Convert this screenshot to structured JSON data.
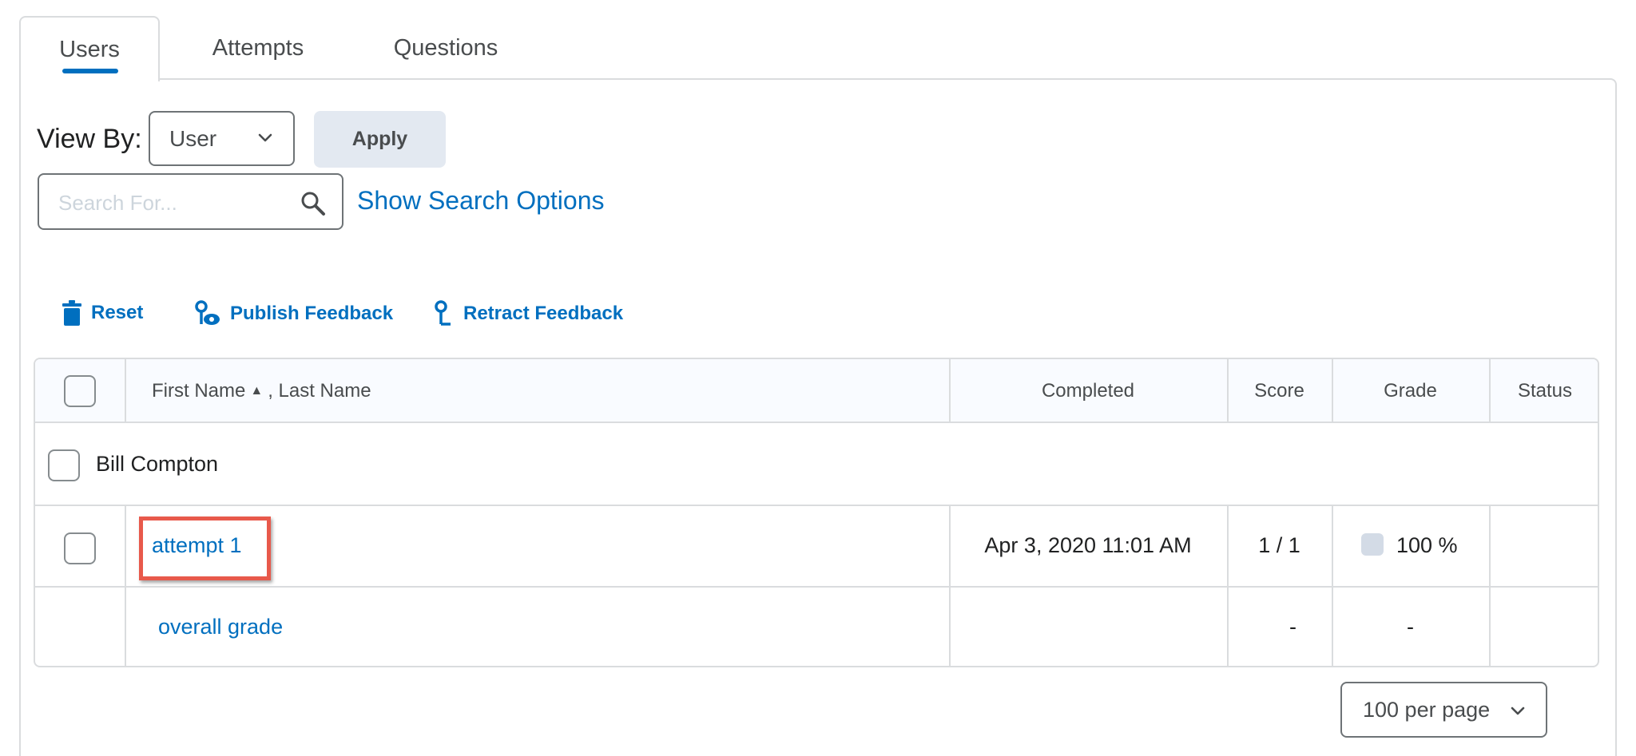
{
  "tabs": [
    {
      "label": "Users",
      "active": true
    },
    {
      "label": "Attempts",
      "active": false
    },
    {
      "label": "Questions",
      "active": false
    }
  ],
  "view_by": {
    "label": "View By:",
    "selected": "User",
    "apply_label": "Apply"
  },
  "search": {
    "placeholder": "Search For...",
    "value": "",
    "show_options_label": "Show Search Options"
  },
  "actions": {
    "reset": "Reset",
    "publish": "Publish Feedback",
    "retract": "Retract Feedback"
  },
  "table": {
    "headers": {
      "name_first": "First Name",
      "sort_glyph": "▲",
      "name_last": ", Last Name",
      "completed": "Completed",
      "score": "Score",
      "grade": "Grade",
      "status": "Status"
    },
    "user": {
      "name": "Bill Compton"
    },
    "attempt": {
      "label": "attempt 1",
      "completed": "Apr 3, 2020 11:01 AM",
      "score": "1 / 1",
      "grade": "100 %",
      "status": ""
    },
    "overall": {
      "label": "overall grade",
      "score": "-",
      "grade": "-"
    }
  },
  "pagination": {
    "per_page": "100 per page"
  },
  "colors": {
    "link": "#006fbf",
    "highlight": "#e8594b",
    "border": "#dadcde"
  }
}
